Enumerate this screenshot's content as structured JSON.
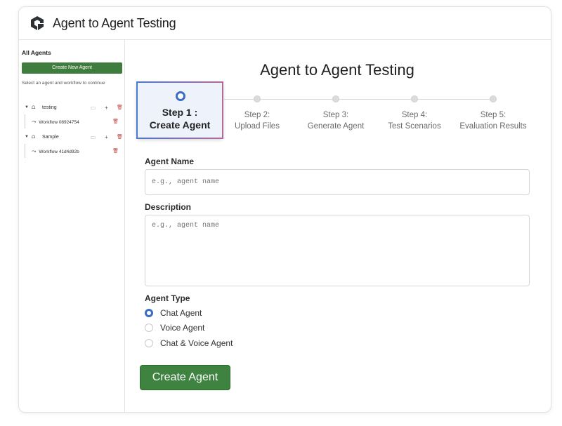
{
  "header": {
    "title": "Agent to Agent Testing",
    "logo_icon": "logo-icon"
  },
  "sidebar": {
    "title": "All Agents",
    "create_button": "Create New Agent",
    "hint": "Select an agent and workflow to continue",
    "agents": [
      {
        "name": "testing",
        "workflow": "Workflow 08924754"
      },
      {
        "name": "Sample",
        "workflow": "Workflow 41d4d92b"
      }
    ]
  },
  "main": {
    "title": "Agent to Agent Testing",
    "steps": [
      {
        "line1": "Step 1 :",
        "line2": "Create Agent",
        "active": true
      },
      {
        "line1": "Step 2:",
        "line2": "Upload Files",
        "active": false
      },
      {
        "line1": "Step 3:",
        "line2": "Generate Agent",
        "active": false
      },
      {
        "line1": "Step 4:",
        "line2": "Test Scenarios",
        "active": false
      },
      {
        "line1": "Step 5:",
        "line2": "Evaluation Results",
        "active": false
      }
    ],
    "form": {
      "name_label": "Agent Name",
      "name_placeholder": "e.g., agent name",
      "description_label": "Description",
      "description_placeholder": "e.g., agent name",
      "type_label": "Agent Type",
      "types": [
        "Chat Agent",
        "Voice Agent",
        "Chat & Voice Agent"
      ],
      "selected_type": "Chat Agent",
      "submit_label": "Create Agent"
    }
  },
  "colors": {
    "primary_green": "#3e8440",
    "accent_blue": "#3b6dc6",
    "delete_red": "#c0443c"
  }
}
